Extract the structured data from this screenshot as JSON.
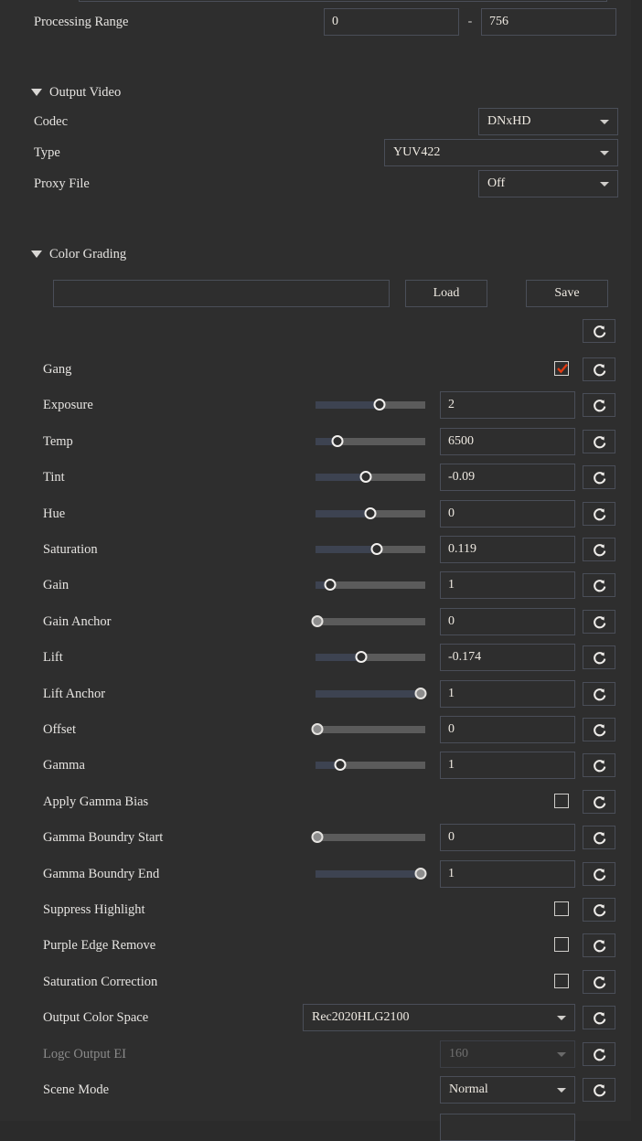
{
  "app": {
    "panel_title": "color-grading-settings-panel",
    "accent_check_color": "#e03a12",
    "background": "#2e2e2e",
    "border_color": "#4a4e58",
    "slider_fill_color": "#3d4351",
    "slider_track_color": "#5b5b5b"
  },
  "processing": {
    "label": "Processing Range",
    "start_value": "0",
    "end_value": "756",
    "separator": "-"
  },
  "output_video": {
    "section_label": "Output Video",
    "expanded": true,
    "rows": [
      {
        "label": "Codec",
        "value": "DNxHD"
      },
      {
        "label": "Type",
        "value": "YUV422"
      },
      {
        "label": "Proxy File",
        "value": "Off"
      }
    ]
  },
  "color_grading": {
    "section_label": "Color Grading",
    "expanded": true,
    "preset_field_value": "",
    "preset_field_placeholder": "",
    "load_label": "Load",
    "save_label": "Save",
    "rows": [
      {
        "name": "gang",
        "label": "Gang",
        "type": "checkbox",
        "checked": true,
        "enabled": true
      },
      {
        "name": "exposure",
        "label": "Exposure",
        "type": "slider",
        "value": "2",
        "pos": 0.58,
        "enabled": true
      },
      {
        "name": "temp",
        "label": "Temp",
        "type": "slider",
        "value": "6500",
        "pos": 0.2,
        "enabled": true
      },
      {
        "name": "tint",
        "label": "Tint",
        "type": "slider",
        "value": "-0.09",
        "pos": 0.455,
        "enabled": true
      },
      {
        "name": "hue",
        "label": "Hue",
        "type": "slider",
        "value": "0",
        "pos": 0.5,
        "enabled": true
      },
      {
        "name": "saturation",
        "label": "Saturation",
        "type": "slider",
        "value": "0.119",
        "pos": 0.555,
        "enabled": true
      },
      {
        "name": "gain",
        "label": "Gain",
        "type": "slider",
        "value": "1",
        "pos": 0.135,
        "enabled": true
      },
      {
        "name": "gain-anchor",
        "label": "Gain Anchor",
        "type": "slider",
        "value": "0",
        "pos": 0.015,
        "enabled": false
      },
      {
        "name": "lift",
        "label": "Lift",
        "type": "slider",
        "value": "-0.174",
        "pos": 0.42,
        "enabled": true
      },
      {
        "name": "lift-anchor",
        "label": "Lift Anchor",
        "type": "slider",
        "value": "1",
        "pos": 0.955,
        "enabled": false
      },
      {
        "name": "offset",
        "label": "Offset",
        "type": "slider",
        "value": "0",
        "pos": 0.015,
        "enabled": false
      },
      {
        "name": "gamma",
        "label": "Gamma",
        "type": "slider",
        "value": "1",
        "pos": 0.225,
        "enabled": true
      },
      {
        "name": "apply-gamma-bias",
        "label": "Apply Gamma Bias",
        "type": "checkbox",
        "checked": false,
        "enabled": true
      },
      {
        "name": "gamma-boundry-start",
        "label": "Gamma Boundry Start",
        "type": "slider",
        "value": "0",
        "pos": 0.015,
        "enabled": false
      },
      {
        "name": "gamma-boundry-end",
        "label": "Gamma Boundry End",
        "type": "slider",
        "value": "1",
        "pos": 0.955,
        "enabled": false
      },
      {
        "name": "suppress-highlight",
        "label": "Suppress Highlight",
        "type": "checkbox",
        "checked": false,
        "enabled": true
      },
      {
        "name": "purple-edge-remove",
        "label": "Purple Edge Remove",
        "type": "checkbox",
        "checked": false,
        "enabled": true
      },
      {
        "name": "saturation-correction",
        "label": "Saturation Correction",
        "type": "checkbox",
        "checked": false,
        "enabled": true
      },
      {
        "name": "output-color-space",
        "label": "Output Color Space",
        "type": "combo",
        "value": "Rec2020HLG2100",
        "enabled": true,
        "wide": true
      },
      {
        "name": "logc-output-ei",
        "label": "Logc Output EI",
        "type": "combo",
        "value": "160",
        "enabled": false,
        "wide": false
      },
      {
        "name": "scene-mode",
        "label": "Scene Mode",
        "type": "combo",
        "value": "Normal",
        "enabled": true,
        "wide": false
      }
    ],
    "reset_icon": "refresh-icon",
    "reset_glyph": "C"
  }
}
